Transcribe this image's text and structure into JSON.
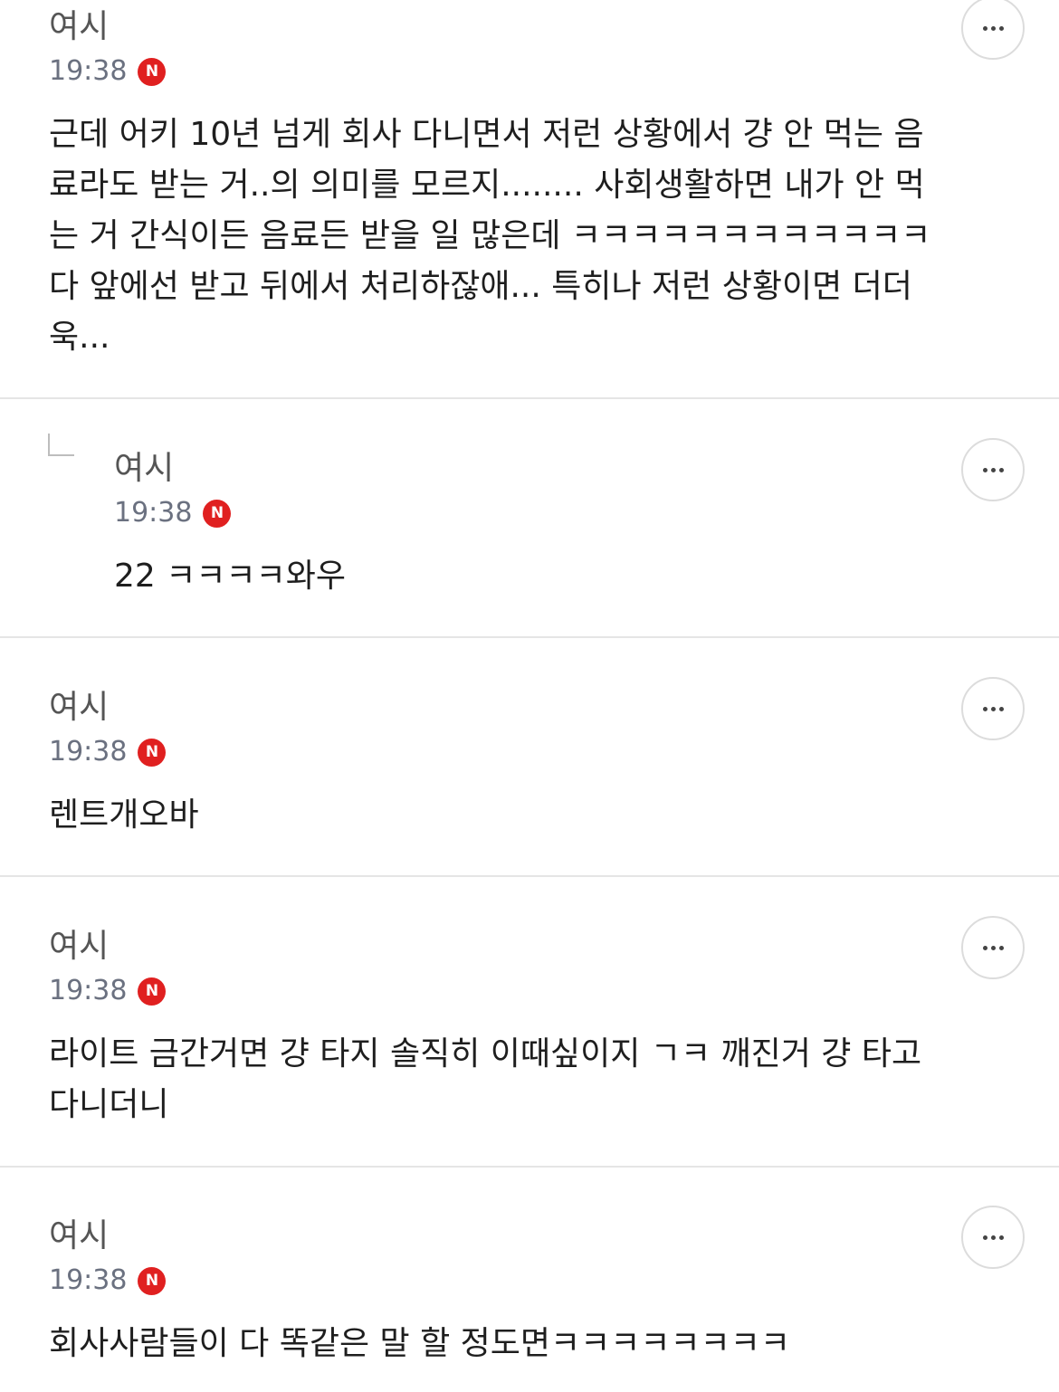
{
  "comments": [
    {
      "author": "여시",
      "time": "19:38",
      "badge": "N",
      "text": "근데 어키 10년 넘게 회사 다니면서 저런 상황에서 걍 안 먹는 음\n료라도 받는 거..의 의미를 모르지........ 사회생활하면 내가 안 먹\n는 거 간식이든 음료든 받을 일 많은데 ㅋㅋㅋㅋㅋㅋㅋㅋㅋㅋㅋㅋ\n다 앞에선 받고 뒤에서 처리하잖애... 특히나 저런 상황이면 더더\n욱..."
    },
    {
      "author": "여시",
      "time": "19:38",
      "badge": "N",
      "text": "22 ㅋㅋㅋㅋ와우",
      "is_reply": true
    },
    {
      "author": "여시",
      "time": "19:38",
      "badge": "N",
      "text": "렌트개오바"
    },
    {
      "author": "여시",
      "time": "19:38",
      "badge": "N",
      "text": "라이트 금간거면 걍 타지 솔직히 이때싶이지 ㄱㅋ 깨진거 걍 타고\n다니더니"
    },
    {
      "author": "여시",
      "time": "19:38",
      "badge": "N",
      "text": "회사사람들이 다 똑같은 말 할 정도면ㅋㅋㅋㅋㅋㅋㅋㅋ"
    }
  ],
  "colors": {
    "badge": "#e02020",
    "author": "#555555",
    "time": "#6b7180",
    "divider": "#e5e5e5",
    "text": "#1e1e1e"
  },
  "icons": {
    "more": "ellipsis-horizontal",
    "reply": "corner-down-right",
    "badge": "new-badge"
  }
}
